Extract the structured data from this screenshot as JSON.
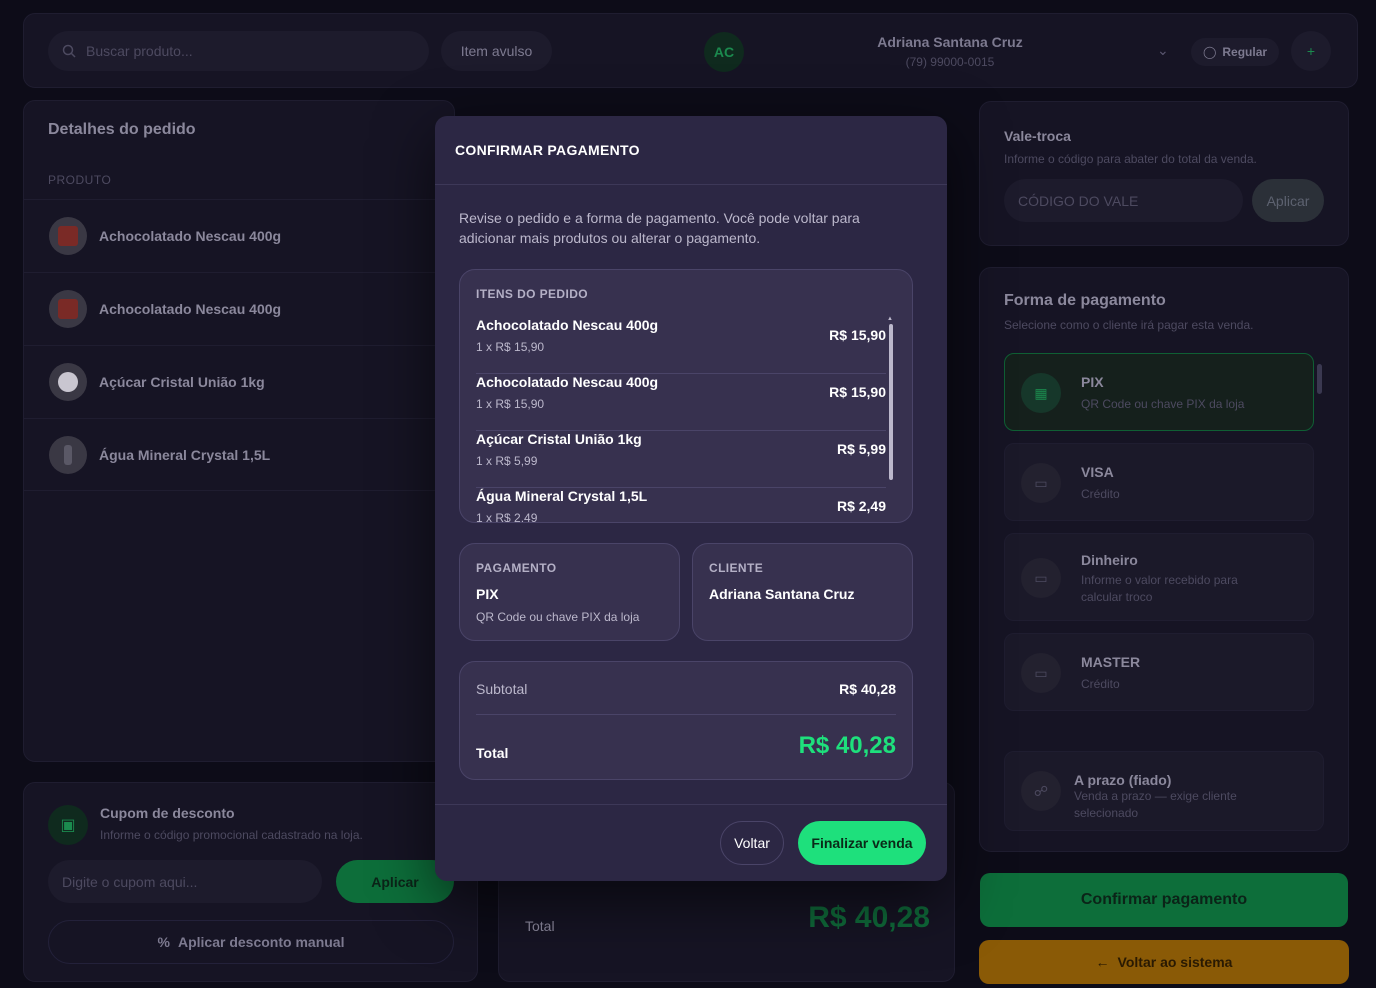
{
  "topbar": {
    "search_placeholder": "Buscar produto...",
    "loose_item": "Item avulso",
    "customer_initials": "AC",
    "customer_name": "Adriana Santana Cruz",
    "customer_phone": "(79) 99000-0015",
    "regular_label": "Regular"
  },
  "order": {
    "title": "Detalhes do pedido",
    "col_product": "PRODUTO",
    "rows": [
      {
        "name": "Achocolatado Nescau 400g"
      },
      {
        "name": "Achocolatado Nescau 400g"
      },
      {
        "name": "Açúcar Cristal União 1kg"
      },
      {
        "name": "Água Mineral Crystal 1,5L"
      }
    ]
  },
  "coupon": {
    "title": "Cupom de desconto",
    "subtitle": "Informe o código promocional cadastrado na loja.",
    "placeholder": "Digite o cupom aqui...",
    "apply": "Aplicar",
    "manual": "Aplicar desconto manual"
  },
  "bg_total": {
    "label": "Total",
    "value": "R$ 40,28"
  },
  "voucher": {
    "title": "Vale-troca",
    "subtitle": "Informe o código para abater do total da venda.",
    "placeholder": "CÓDIGO DO VALE",
    "apply": "Aplicar"
  },
  "payment": {
    "title": "Forma de pagamento",
    "subtitle": "Selecione como o cliente irá pagar esta venda.",
    "options": [
      {
        "name": "PIX",
        "desc": "QR Code ou chave PIX da loja"
      },
      {
        "name": "VISA",
        "desc": "Crédito"
      },
      {
        "name": "Dinheiro",
        "desc": "Informe o valor recebido para calcular troco"
      },
      {
        "name": "MASTER",
        "desc": "Crédito"
      },
      {
        "name": "A prazo (fiado)",
        "desc": "Venda a prazo — exige cliente selecionado"
      }
    ],
    "confirm": "Confirmar pagamento",
    "back": "Voltar ao sistema"
  },
  "modal": {
    "title": "CONFIRMAR PAGAMENTO",
    "description": "Revise o pedido e a forma de pagamento. Você pode voltar para adicionar mais produtos ou alterar o pagamento.",
    "items_label": "ITENS DO PEDIDO",
    "items": [
      {
        "name": "Achocolatado Nescau 400g",
        "qty": "1 x R$ 15,90",
        "price": "R$ 15,90"
      },
      {
        "name": "Achocolatado Nescau 400g",
        "qty": "1 x R$ 15,90",
        "price": "R$ 15,90"
      },
      {
        "name": "Açúcar Cristal União 1kg",
        "qty": "1 x R$ 5,99",
        "price": "R$ 5,99"
      },
      {
        "name": "Água Mineral Crystal 1,5L",
        "qty": "1 x R$ 2,49",
        "price": "R$ 2,49"
      }
    ],
    "payment_label": "PAGAMENTO",
    "payment_name": "PIX",
    "payment_desc": "QR Code ou chave PIX da loja",
    "client_label": "CLIENTE",
    "client_name": "Adriana Santana Cruz",
    "subtotal_label": "Subtotal",
    "subtotal_value": "R$ 40,28",
    "total_label": "Total",
    "total_value": "R$ 40,28",
    "back": "Voltar",
    "finalize": "Finalizar venda"
  },
  "colors": {
    "accent": "#1ee07c",
    "modal_bg": "#2c2744",
    "warning": "#8a5a06"
  }
}
